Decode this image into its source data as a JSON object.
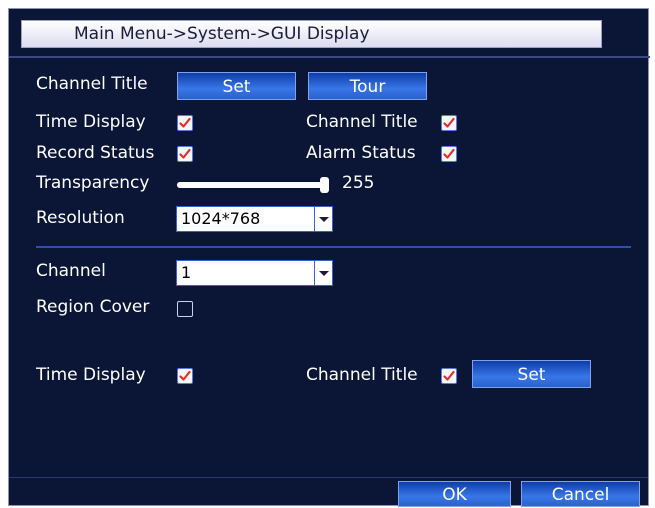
{
  "window": {
    "title": "Main Menu->System->GUI Display"
  },
  "settings": {
    "channel_title_label": "Channel Title",
    "set_button": "Set",
    "tour_button": "Tour",
    "time_display_label": "Time Display",
    "time_display_checked": true,
    "channel_title_toggle_label": "Channel Title",
    "channel_title_checked": true,
    "record_status_label": "Record Status",
    "record_status_checked": true,
    "alarm_status_label": "Alarm Status",
    "alarm_status_checked": true,
    "transparency_label": "Transparency",
    "transparency_value": "255",
    "transparency_fraction": 1.0,
    "resolution_label": "Resolution",
    "resolution_value": "1024*768"
  },
  "channel_section": {
    "channel_label": "Channel",
    "channel_value": "1",
    "region_cover_label": "Region Cover",
    "region_cover_checked": false,
    "time_display_label": "Time Display",
    "time_display_checked": true,
    "channel_title_label": "Channel Title",
    "channel_title_checked": true,
    "set_button": "Set"
  },
  "footer": {
    "ok_button": "OK",
    "cancel_button": "Cancel"
  },
  "colors": {
    "background": "#0b1637",
    "button": "#2f6adf",
    "check_mark": "#e03030",
    "divider": "#2d4fb0"
  },
  "icons": {
    "check": "check-icon",
    "dropdown": "chevron-down-icon"
  }
}
